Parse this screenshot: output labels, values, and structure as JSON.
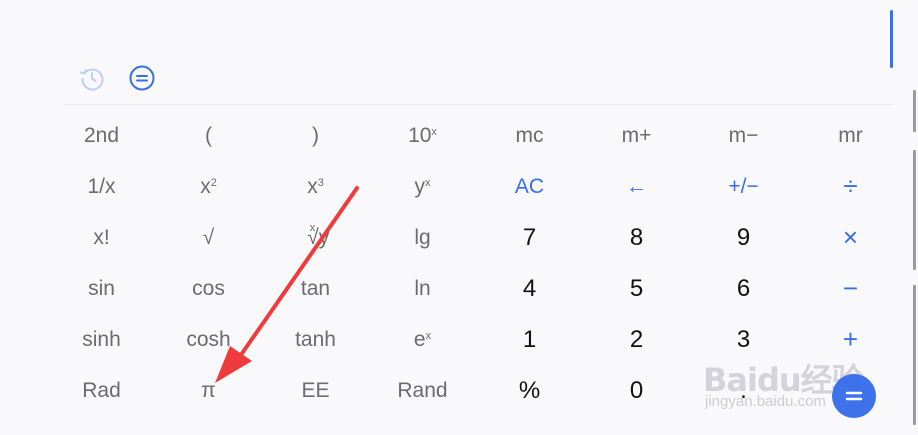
{
  "toolbar": {
    "history_icon": "history-clock-icon",
    "menu_icon": "equals-menu-icon"
  },
  "keys": {
    "r1": [
      "2nd",
      "(",
      ")",
      "10",
      "mc",
      "m+",
      "m−",
      "mr"
    ],
    "r2": [
      "1/x",
      "x",
      "x",
      "y",
      "AC",
      "←",
      "+/−",
      "÷"
    ],
    "r3": [
      "x!",
      "√",
      "√y",
      "lg",
      "7",
      "8",
      "9",
      "×"
    ],
    "r4": [
      "sin",
      "cos",
      "tan",
      "ln",
      "4",
      "5",
      "6",
      "−"
    ],
    "r5": [
      "sinh",
      "cosh",
      "tanh",
      "e",
      "1",
      "2",
      "3",
      "+"
    ],
    "r6": [
      "Rad",
      "π",
      "EE",
      "Rand",
      "%",
      "0",
      "."
    ]
  },
  "superscripts": {
    "ten_pow": "x",
    "x_squared": "2",
    "x_cubed": "3",
    "y_pow": "x",
    "root_index": "x",
    "e_pow": "x"
  },
  "watermark": {
    "logo": "Baidu经验",
    "url": "jingyan.baidu.com"
  },
  "colors": {
    "accent": "#3a6ee8",
    "arrow": "#ef3b3b",
    "text_gray": "#6b6b70",
    "digit": "#111111"
  }
}
